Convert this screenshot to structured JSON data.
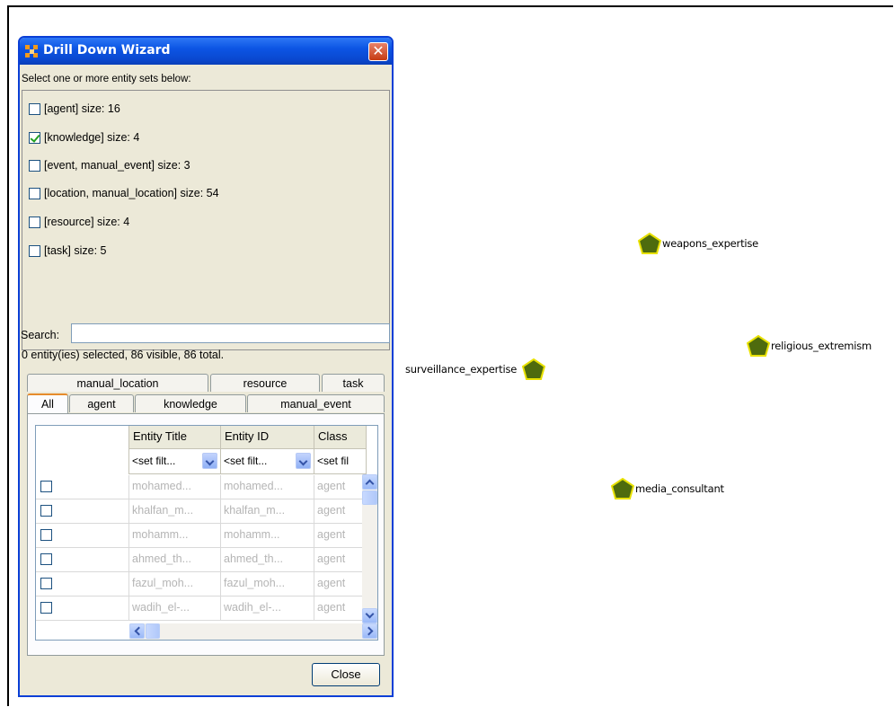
{
  "dialog": {
    "title": "Drill Down Wizard",
    "close_x": "✕",
    "instruction": "Select one or more entity sets below:",
    "entity_sets": [
      {
        "label": "[agent] size: 16",
        "checked": false
      },
      {
        "label": "[knowledge] size: 4",
        "checked": true
      },
      {
        "label": "[event, manual_event] size: 3",
        "checked": false
      },
      {
        "label": "[location, manual_location] size: 54",
        "checked": false
      },
      {
        "label": "[resource] size: 4",
        "checked": false
      },
      {
        "label": "[task] size: 5",
        "checked": false
      }
    ],
    "search_label": "Search:",
    "search_value": "",
    "status": "0 entity(ies) selected, 86 visible, 86 total.",
    "tabs_row1": [
      "manual_location",
      "resource",
      "task"
    ],
    "tabs_row2": [
      "All",
      "agent",
      "knowledge",
      "manual_event"
    ],
    "active_tab": "All",
    "table": {
      "headers": [
        "Entity Title",
        "Entity ID",
        "Class"
      ],
      "filters": [
        "<set filt...",
        "<set filt...",
        "<set fil"
      ],
      "rows": [
        [
          "mohamed...",
          "mohamed...",
          "agent"
        ],
        [
          "khalfan_m...",
          "khalfan_m...",
          "agent"
        ],
        [
          "mohamm...",
          "mohamm...",
          "agent"
        ],
        [
          "ahmed_th...",
          "ahmed_th...",
          "agent"
        ],
        [
          "fazul_moh...",
          "fazul_moh...",
          "agent"
        ],
        [
          "wadih_el-...",
          "wadih_el-...",
          "agent"
        ]
      ]
    },
    "close_button": "Close"
  },
  "graph": {
    "node_color": "#4e6b0e",
    "node_outline": "#e8e100",
    "nodes": [
      "weapons_expertise",
      "religious_extremism",
      "surveillance_expertise",
      "media_consultant"
    ]
  }
}
